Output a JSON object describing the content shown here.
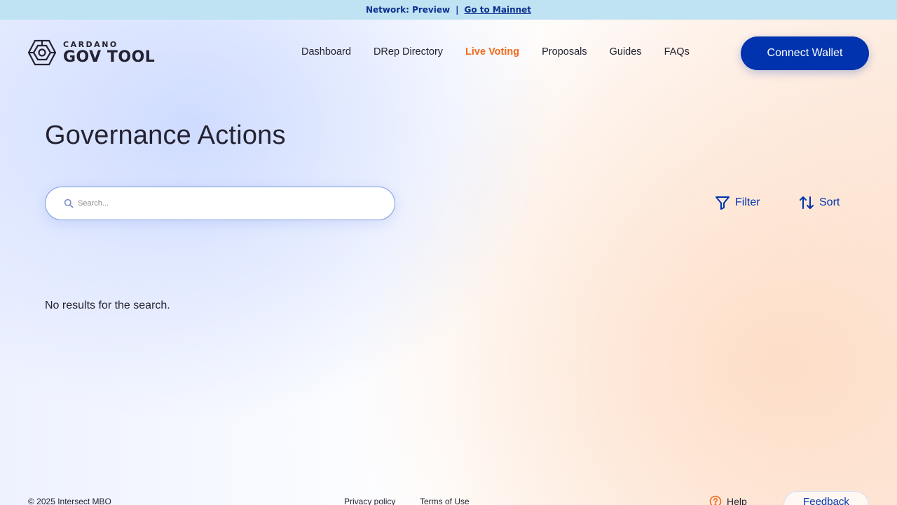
{
  "banner": {
    "network_text": "Network: Preview",
    "separator": "|",
    "mainnet_link": "Go to Mainnet"
  },
  "logo": {
    "small_text": "CARDANO",
    "big_text": "GOV TOOL",
    "icon": "hexagon-logo-icon"
  },
  "nav": {
    "items": [
      {
        "label": "Dashboard",
        "active": false
      },
      {
        "label": "DRep Directory",
        "active": false
      },
      {
        "label": "Live Voting",
        "active": true
      },
      {
        "label": "Proposals",
        "active": false
      },
      {
        "label": "Guides",
        "active": false
      },
      {
        "label": "FAQs",
        "active": false
      }
    ],
    "connect_wallet": "Connect Wallet"
  },
  "main": {
    "title": "Governance Actions",
    "search": {
      "placeholder": "Search...",
      "value": ""
    },
    "filter_label": "Filter",
    "sort_label": "Sort",
    "empty_message": "No results for the search."
  },
  "footer": {
    "copyright": "© 2025 Intersect MBO",
    "privacy": "Privacy policy",
    "terms": "Terms of Use",
    "help": "Help",
    "feedback": "Feedback"
  },
  "colors": {
    "primary": "#0033ad",
    "active_nav": "#f26a1b",
    "banner_bg": "#bfe3f2",
    "text": "#242232"
  }
}
